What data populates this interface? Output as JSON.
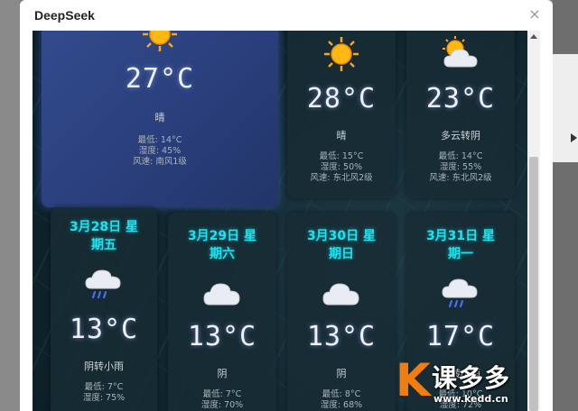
{
  "dialog": {
    "title": "DeepSeek",
    "close": "×"
  },
  "today": {
    "temp": "27°C",
    "condition": "晴",
    "low": "最低: 14°C",
    "humidity": "湿度: 45%",
    "wind": "风速: 南风1级"
  },
  "top_cards": [
    {
      "temp": "28°C",
      "condition": "晴",
      "low": "最低: 15°C",
      "humidity": "湿度: 50%",
      "wind": "风速: 东北风2级",
      "icon": "sun-icon"
    },
    {
      "temp": "23°C",
      "condition": "多云转阴",
      "low": "最低: 14°C",
      "humidity": "湿度: 55%",
      "wind": "风速: 东北风2级",
      "icon": "partly-cloudy-icon"
    }
  ],
  "bottom_cards": [
    {
      "date_line1": "3月28日 星",
      "date_line2": "期五",
      "temp": "13°C",
      "condition": "阴转小雨",
      "low": "最低: 7°C",
      "humidity": "湿度: 75%",
      "icon": "rain-cloud-icon"
    },
    {
      "date_line1": "3月29日 星",
      "date_line2": "期六",
      "temp": "13°C",
      "condition": "阴",
      "low": "最低: 7°C",
      "humidity": "湿度: 70%",
      "icon": "cloud-icon"
    },
    {
      "date_line1": "3月30日 星",
      "date_line2": "期日",
      "temp": "13°C",
      "condition": "阴",
      "low": "最低: 8°C",
      "humidity": "湿度: 68%",
      "icon": "cloud-icon"
    },
    {
      "date_line1": "3月31日 星",
      "date_line2": "期一",
      "temp": "17°C",
      "condition": "阴转小雨",
      "low": "最低: 10°C",
      "humidity": "湿度: 72%",
      "icon": "rain-cloud-icon"
    }
  ],
  "watermark": {
    "text": "课多多",
    "url": "www.kedd.cn"
  },
  "colors": {
    "date_cyan": "#1ee3ef",
    "today_blue": "#334c8e",
    "watermark_orange": "#f07c12"
  }
}
